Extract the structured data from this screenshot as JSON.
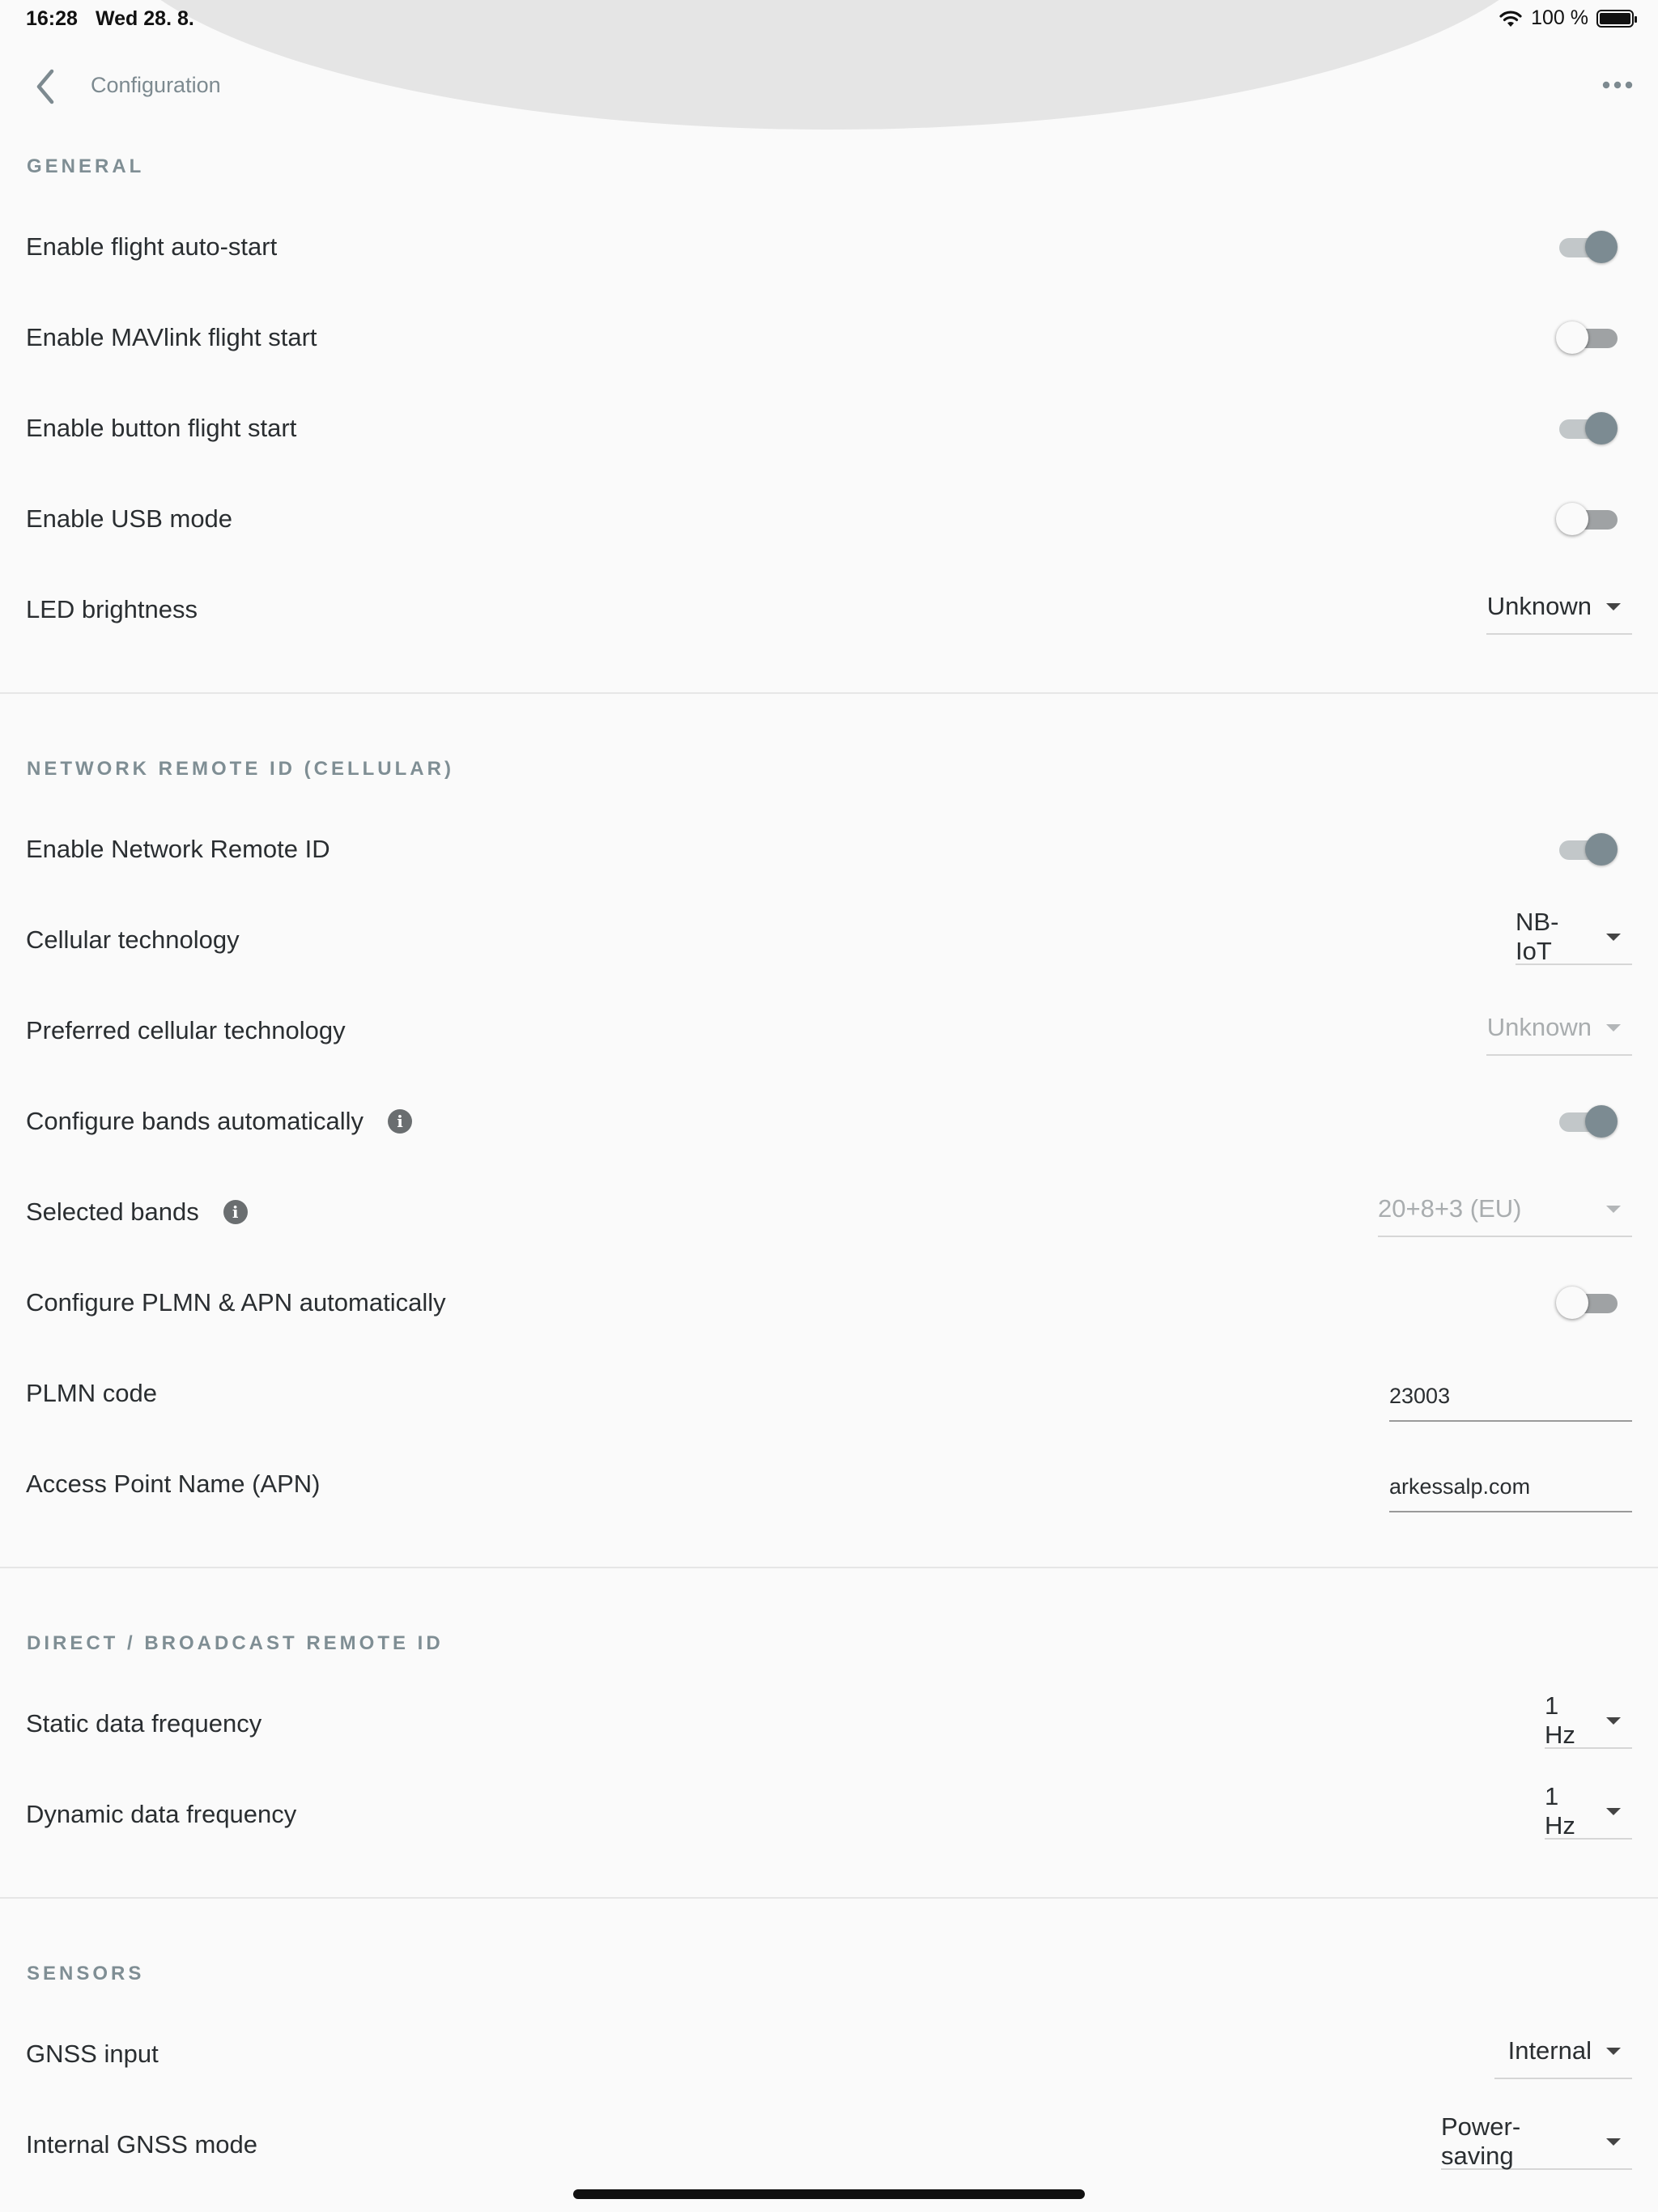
{
  "status_bar": {
    "time": "16:28",
    "date": "Wed 28. 8.",
    "battery": "100 %"
  },
  "nav": {
    "title": "Configuration"
  },
  "sections": {
    "general": {
      "title": "GENERAL",
      "flight_auto_start": {
        "label": "Enable flight auto-start",
        "on": true
      },
      "mavlink_flight_start": {
        "label": "Enable MAVlink flight start",
        "on": false
      },
      "button_flight_start": {
        "label": "Enable button flight start",
        "on": true
      },
      "usb_mode": {
        "label": "Enable USB mode",
        "on": false
      },
      "led_brightness": {
        "label": "LED brightness",
        "value": "Unknown"
      }
    },
    "network": {
      "title": "NETWORK REMOTE ID (CELLULAR)",
      "enable_network_remote_id": {
        "label": "Enable Network Remote ID",
        "on": true
      },
      "cellular_technology": {
        "label": "Cellular technology",
        "value": "NB-IoT"
      },
      "preferred_cellular_technology": {
        "label": "Preferred cellular technology",
        "value": "Unknown"
      },
      "configure_bands": {
        "label": "Configure bands automatically",
        "on": true
      },
      "selected_bands": {
        "label": "Selected bands",
        "value": "20+8+3 (EU)"
      },
      "configure_plmn_apn": {
        "label": "Configure PLMN & APN automatically",
        "on": false
      },
      "plmn_code": {
        "label": "PLMN code",
        "value": "23003"
      },
      "apn": {
        "label": "Access Point Name (APN)",
        "value": "arkessalp.com"
      }
    },
    "broadcast": {
      "title": "DIRECT / BROADCAST REMOTE ID",
      "static_data_frequency": {
        "label": "Static data frequency",
        "value": "1 Hz"
      },
      "dynamic_data_frequency": {
        "label": "Dynamic data frequency",
        "value": "1 Hz"
      }
    },
    "sensors": {
      "title": "SENSORS",
      "gnss_input": {
        "label": "GNSS input",
        "value": "Internal"
      },
      "internal_gnss_mode": {
        "label": "Internal GNSS mode",
        "value": "Power-saving"
      }
    }
  }
}
